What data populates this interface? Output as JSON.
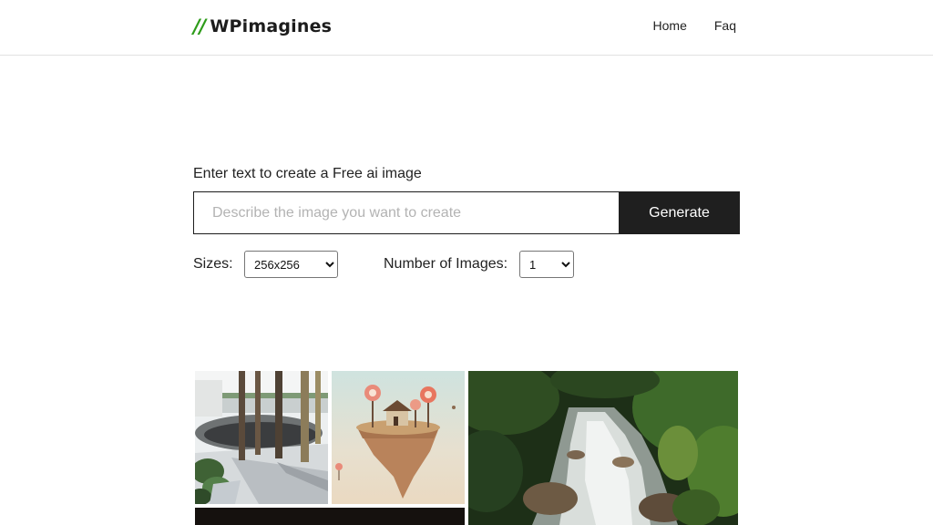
{
  "header": {
    "logo_mark": "//",
    "logo_text": "WPimagines",
    "nav": [
      {
        "label": "Home"
      },
      {
        "label": "Faq"
      }
    ]
  },
  "generator": {
    "label": "Enter text to create a Free ai image",
    "placeholder": "Describe the image you want to create",
    "button_label": "Generate",
    "sizes_label": "Sizes:",
    "size_selected": "256x256",
    "count_label": "Number of Images:",
    "count_selected": "1"
  },
  "gallery": {
    "images": [
      {
        "subject": "modern courtyard with trees"
      },
      {
        "subject": "floating island with lollipop trees and house"
      },
      {
        "subject": "forest waterfall stream"
      },
      {
        "subject": "dark image (partially visible)"
      }
    ]
  },
  "colors": {
    "accent": "#2e9c1a",
    "button_bg": "#1f1f1f",
    "border": "#1c1c1c"
  }
}
